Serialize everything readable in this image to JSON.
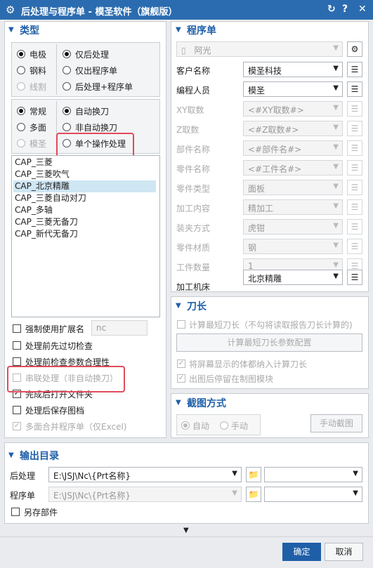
{
  "title": "后处理与程序单 - 模圣软件（旗舰版）",
  "type_section": {
    "title": "类型",
    "group1_left": [
      {
        "label": "电极",
        "checked": true,
        "disabled": false
      },
      {
        "label": "钢料",
        "checked": false,
        "disabled": false
      },
      {
        "label": "线割",
        "checked": false,
        "disabled": true
      }
    ],
    "group1_right": [
      {
        "label": "仅后处理",
        "checked": true
      },
      {
        "label": "仅出程序单",
        "checked": false
      },
      {
        "label": "后处理+程序单",
        "checked": false
      }
    ],
    "group2_left": [
      {
        "label": "常规",
        "checked": true,
        "disabled": false
      },
      {
        "label": "多面",
        "checked": false,
        "disabled": false
      },
      {
        "label": "模圣",
        "checked": false,
        "disabled": true
      }
    ],
    "group2_right": [
      {
        "label": "自动换刀",
        "checked": true
      },
      {
        "label": "非自动换刀",
        "checked": false
      },
      {
        "label": "单个操作处理",
        "checked": false
      }
    ],
    "post_list": [
      "CAP_三菱",
      "CAP_三菱吹气",
      "CAP_北京精雕",
      "CAP_三菱自动对刀",
      "CAP_多轴",
      "CAP_三菱无备刀",
      "CAP_新代无备刀"
    ],
    "selected_index": 2,
    "force_ext_label": "强制使用扩展名",
    "force_ext_value": "nc",
    "checks": [
      {
        "label": "处理前先过切检查",
        "checked": false,
        "disabled": false
      },
      {
        "label": "处理前检查参数合理性",
        "checked": false,
        "disabled": false
      },
      {
        "label": "串联处理（非自动换刀）",
        "checked": false,
        "disabled": true
      },
      {
        "label": "完成后打开文件夹",
        "checked": true,
        "disabled": false
      },
      {
        "label": "处理后保存图档",
        "checked": false,
        "disabled": false
      },
      {
        "label": "多面合并程序单（仅Excel)",
        "checked": true,
        "disabled": true
      }
    ]
  },
  "program_section": {
    "title": "程序单",
    "template": "阿光",
    "fields": [
      {
        "label": "客户名称",
        "value": "模圣科技",
        "disabled": false
      },
      {
        "label": "编程人员",
        "value": "模圣",
        "disabled": false
      },
      {
        "label": "XY取数",
        "value": "<#XY取数#>",
        "disabled": true
      },
      {
        "label": "Z取数",
        "value": "<#Z取数#>",
        "disabled": true
      },
      {
        "label": "部件名称",
        "value": "<#部件名#>",
        "disabled": true
      },
      {
        "label": "零件名称",
        "value": "<#工件名#>",
        "disabled": true
      },
      {
        "label": "零件类型",
        "value": "面板",
        "disabled": true
      },
      {
        "label": "加工内容",
        "value": "精加工",
        "disabled": true
      },
      {
        "label": "装夹方式",
        "value": "虎钳",
        "disabled": true
      },
      {
        "label": "零件材质",
        "value": "钢",
        "disabled": true
      },
      {
        "label": "工件数量",
        "value": "1",
        "disabled": true
      },
      {
        "label": "加工机床",
        "value": "北京精雕",
        "disabled": false
      }
    ]
  },
  "tool_section": {
    "title": "刀长",
    "calc_shortest_label": "计算最短刀长（不勾将读取报告刀长计算的)",
    "config_button": "计算最短刀长参数配置",
    "include_body_label": "将屏幕显示的体都纳入计算刀长",
    "stay_label": "出图后停留在制图模块"
  },
  "screenshot_section": {
    "title": "截图方式",
    "auto_label": "自动",
    "manual_label": "手动",
    "manual_button": "手动截图"
  },
  "output_section": {
    "title": "输出目录",
    "post_label": "后处理",
    "post_path": "E:\\JSJ\\Nc\\{Prt名称}",
    "prog_label": "程序单",
    "prog_path": "E:\\JSJ\\Nc\\{Prt名称}",
    "save_part_label": "另存部件"
  },
  "footer": {
    "ok": "确定",
    "cancel": "取消"
  },
  "colors": {
    "titlebar": "#2b6cb0",
    "accent": "#1f5fa8",
    "highlight": "#e04b5a"
  }
}
